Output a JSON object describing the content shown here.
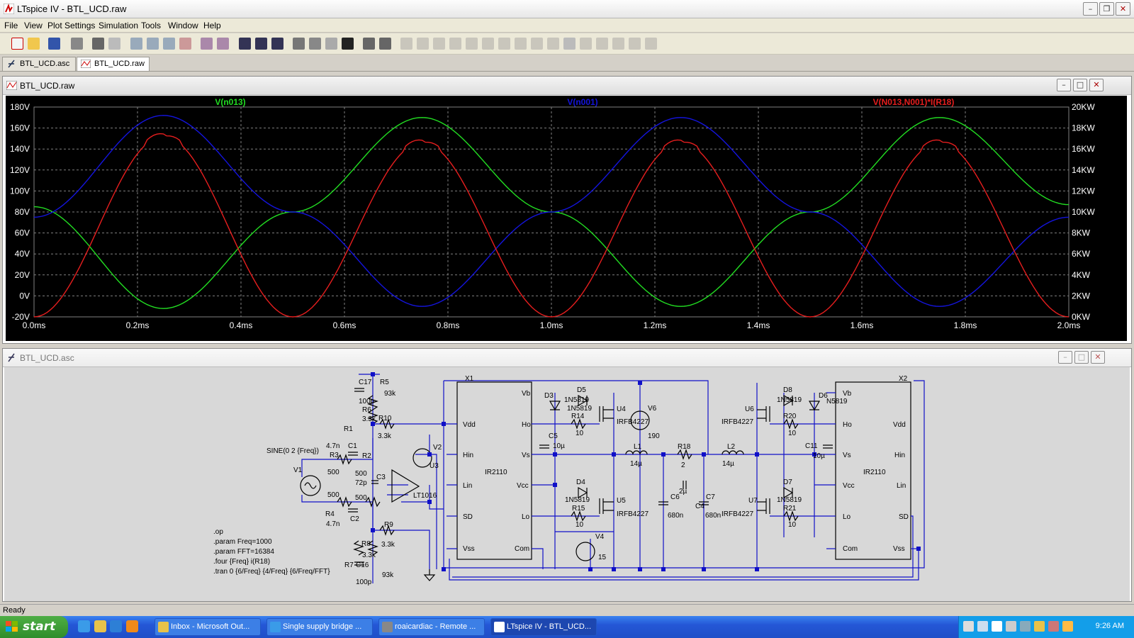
{
  "app": {
    "title": "LTspice IV - BTL_UCD.raw"
  },
  "menu": [
    "File",
    "View",
    "Plot Settings",
    "Simulation",
    "Tools",
    "Window",
    "Help"
  ],
  "tabs": [
    {
      "label": "BTL_UCD.asc",
      "active": false
    },
    {
      "label": "BTL_UCD.raw",
      "active": true
    }
  ],
  "plot_window": {
    "title": "BTL_UCD.raw"
  },
  "schematic_window": {
    "title": "BTL_UCD.asc"
  },
  "chart_data": {
    "type": "line",
    "x_ticks": [
      "0.0ms",
      "0.2ms",
      "0.4ms",
      "0.6ms",
      "0.8ms",
      "1.0ms",
      "1.2ms",
      "1.4ms",
      "1.6ms",
      "1.8ms",
      "2.0ms"
    ],
    "xlim": [
      0,
      2.0
    ],
    "y_left_ticks": [
      "180V",
      "160V",
      "140V",
      "120V",
      "100V",
      "80V",
      "60V",
      "40V",
      "20V",
      "0V",
      "-20V"
    ],
    "ylim_left": [
      -20,
      180
    ],
    "y_right_ticks": [
      "20KW",
      "18KW",
      "16KW",
      "14KW",
      "12KW",
      "10KW",
      "8KW",
      "6KW",
      "4KW",
      "2KW",
      "0KW"
    ],
    "ylim_right": [
      0,
      20
    ],
    "grid": true,
    "series": [
      {
        "name": "V(n013)",
        "color": "#22dd22",
        "axis": "left",
        "x": [
          0,
          0.25,
          0.5,
          0.75,
          1.0,
          1.25,
          1.5,
          1.75,
          2.0
        ],
        "values": [
          85,
          -12,
          80,
          170,
          80,
          -10,
          80,
          170,
          87
        ]
      },
      {
        "name": "V(n001)",
        "color": "#1414dd",
        "axis": "left",
        "x": [
          0,
          0.25,
          0.5,
          0.75,
          1.0,
          1.25,
          1.5,
          1.75,
          2.0
        ],
        "values": [
          75,
          172,
          80,
          -10,
          80,
          170,
          80,
          -10,
          75
        ]
      },
      {
        "name": "V(N013,N001)*I(R18)",
        "color": "#e61e1e",
        "axis": "right",
        "x": [
          0,
          0.25,
          0.5,
          0.75,
          1.0,
          1.25,
          1.5,
          1.75,
          2.0
        ],
        "values": [
          0,
          17.2,
          0,
          16.6,
          0,
          16.6,
          0,
          16.6,
          0
        ]
      }
    ]
  },
  "schematic": {
    "directives": [
      ".op",
      ".param Freq=1000",
      ".param FFT=16384",
      ".four {Freq} i(R18)",
      ".tran 0 {6/Freq} {4/Freq} {6/Freq/FFT}"
    ],
    "source_label": "SINE(0 2 {Freq})",
    "labels": [
      {
        "t": "C17",
        "k": "c17"
      },
      {
        "t": "100p",
        "k": "c17v"
      },
      {
        "t": "R5",
        "k": "r5"
      },
      {
        "t": "93k",
        "k": "r5v"
      },
      {
        "t": "R6",
        "k": "r6"
      },
      {
        "t": "3.3k",
        "k": "r6v"
      },
      {
        "t": "R1",
        "k": "r1"
      },
      {
        "t": "R10",
        "k": "r10"
      },
      {
        "t": "3.3k",
        "k": "r10v"
      },
      {
        "t": "4.7n",
        "k": "c1v"
      },
      {
        "t": "C1",
        "k": "c1"
      },
      {
        "t": "R3",
        "k": "r3"
      },
      {
        "t": "500",
        "k": "r3v"
      },
      {
        "t": "R2",
        "k": "r2"
      },
      {
        "t": "500",
        "k": "r2v"
      },
      {
        "t": "C3",
        "k": "c3"
      },
      {
        "t": "72p",
        "k": "c3v"
      },
      {
        "t": "V1",
        "k": "v1"
      },
      {
        "t": "500",
        "k": "r4v"
      },
      {
        "t": "R4",
        "k": "r4"
      },
      {
        "t": "4.7n",
        "k": "c2v"
      },
      {
        "t": "C2",
        "k": "c2"
      },
      {
        "t": "500",
        "k": "r11v"
      },
      {
        "t": "V2",
        "k": "v2"
      },
      {
        "t": "U3",
        "k": "u3"
      },
      {
        "t": "LT1016",
        "k": "lt"
      },
      {
        "t": "R9",
        "k": "r9"
      },
      {
        "t": "3.3k",
        "k": "r9v"
      },
      {
        "t": "R8",
        "k": "r8"
      },
      {
        "t": "3.3k",
        "k": "r8v"
      },
      {
        "t": "R7",
        "k": "r7"
      },
      {
        "t": "C16",
        "k": "c16"
      },
      {
        "t": "93k",
        "k": "r7v"
      },
      {
        "t": "100p",
        "k": "c16v"
      },
      {
        "t": "X1",
        "k": "x1"
      },
      {
        "t": "Vdd",
        "k": "x1vdd"
      },
      {
        "t": "Hin",
        "k": "x1hin"
      },
      {
        "t": "Lin",
        "k": "x1lin"
      },
      {
        "t": "SD",
        "k": "x1sd"
      },
      {
        "t": "Vss",
        "k": "x1vss"
      },
      {
        "t": "IR2110",
        "k": "x1name"
      },
      {
        "t": "Vb",
        "k": "x1vb"
      },
      {
        "t": "Ho",
        "k": "x1ho"
      },
      {
        "t": "Vs",
        "k": "x1vs"
      },
      {
        "t": "Vcc",
        "k": "x1vcc"
      },
      {
        "t": "Lo",
        "k": "x1lo"
      },
      {
        "t": "Com",
        "k": "x1com"
      },
      {
        "t": "D3",
        "k": "d3"
      },
      {
        "t": "D5",
        "k": "d5"
      },
      {
        "t": "1N5819",
        "k": "d5v"
      },
      {
        "t": "1N5819",
        "k": "r14a"
      },
      {
        "t": "R14",
        "k": "r14"
      },
      {
        "t": "10",
        "k": "r14v"
      },
      {
        "t": "U4",
        "k": "u4"
      },
      {
        "t": "IRFB4227",
        "k": "u4v"
      },
      {
        "t": "V6",
        "k": "v6"
      },
      {
        "t": "190",
        "k": "v6v"
      },
      {
        "t": "C5",
        "k": "c5"
      },
      {
        "t": "10µ",
        "k": "c5v"
      },
      {
        "t": "L1",
        "k": "l1"
      },
      {
        "t": "14µ",
        "k": "l1v"
      },
      {
        "t": "R18",
        "k": "r18"
      },
      {
        "t": "2",
        "k": "r18v"
      },
      {
        "t": "L2",
        "k": "l2"
      },
      {
        "t": "14µ",
        "k": "l2v"
      },
      {
        "t": "D4",
        "k": "d4"
      },
      {
        "t": "1N5819",
        "k": "d4v"
      },
      {
        "t": "R15",
        "k": "r15"
      },
      {
        "t": "10",
        "k": "r15v"
      },
      {
        "t": "U5",
        "k": "u5"
      },
      {
        "t": "IRFB4227",
        "k": "u5v"
      },
      {
        "t": "C6",
        "k": "c6"
      },
      {
        "t": "2µ",
        "k": "c4v"
      },
      {
        "t": "C4",
        "k": "c4"
      },
      {
        "t": "C7",
        "k": "c7"
      },
      {
        "t": "680n",
        "k": "c6v"
      },
      {
        "t": "680n",
        "k": "c7v"
      },
      {
        "t": "V4",
        "k": "v4"
      },
      {
        "t": "15",
        "k": "v4v"
      },
      {
        "t": "D8",
        "k": "d8"
      },
      {
        "t": "1N5819",
        "k": "d8v"
      },
      {
        "t": "D6",
        "k": "d6"
      },
      {
        "t": "N5819",
        "k": "d6v"
      },
      {
        "t": "U6",
        "k": "u6"
      },
      {
        "t": "IRFB4227",
        "k": "u6v"
      },
      {
        "t": "R20",
        "k": "r20"
      },
      {
        "t": "10",
        "k": "r20v"
      },
      {
        "t": "C11",
        "k": "c11"
      },
      {
        "t": "10µ",
        "k": "c11v"
      },
      {
        "t": "D7",
        "k": "d7"
      },
      {
        "t": "1N5819",
        "k": "d7v"
      },
      {
        "t": "U7",
        "k": "u7"
      },
      {
        "t": "IRFB4227",
        "k": "u7v"
      },
      {
        "t": "R21",
        "k": "r21"
      },
      {
        "t": "10",
        "k": "r21v"
      },
      {
        "t": "X2",
        "k": "x2"
      },
      {
        "t": "Vb",
        "k": "x2vb"
      },
      {
        "t": "Ho",
        "k": "x2ho"
      },
      {
        "t": "Vs",
        "k": "x2vs"
      },
      {
        "t": "Vcc",
        "k": "x2vcc"
      },
      {
        "t": "Lo",
        "k": "x2lo"
      },
      {
        "t": "Com",
        "k": "x2com"
      },
      {
        "t": "IR2110",
        "k": "x2name"
      },
      {
        "t": "Vdd",
        "k": "x2vdd"
      },
      {
        "t": "Hin",
        "k": "x2hin"
      },
      {
        "t": "Lin",
        "k": "x2lin"
      },
      {
        "t": "SD",
        "k": "x2sd"
      },
      {
        "t": "Vss",
        "k": "x2vss"
      }
    ]
  },
  "status": {
    "text": "Ready"
  },
  "taskbar": {
    "start_label": "start",
    "tasks": [
      {
        "label": "Inbox - Microsoft Out...",
        "active": false
      },
      {
        "label": "Single supply bridge ...",
        "active": false
      },
      {
        "label": "roaicardiac - Remote ...",
        "active": false
      },
      {
        "label": "LTspice IV - BTL_UCD...",
        "active": true
      }
    ],
    "clock": "9:26 AM"
  }
}
